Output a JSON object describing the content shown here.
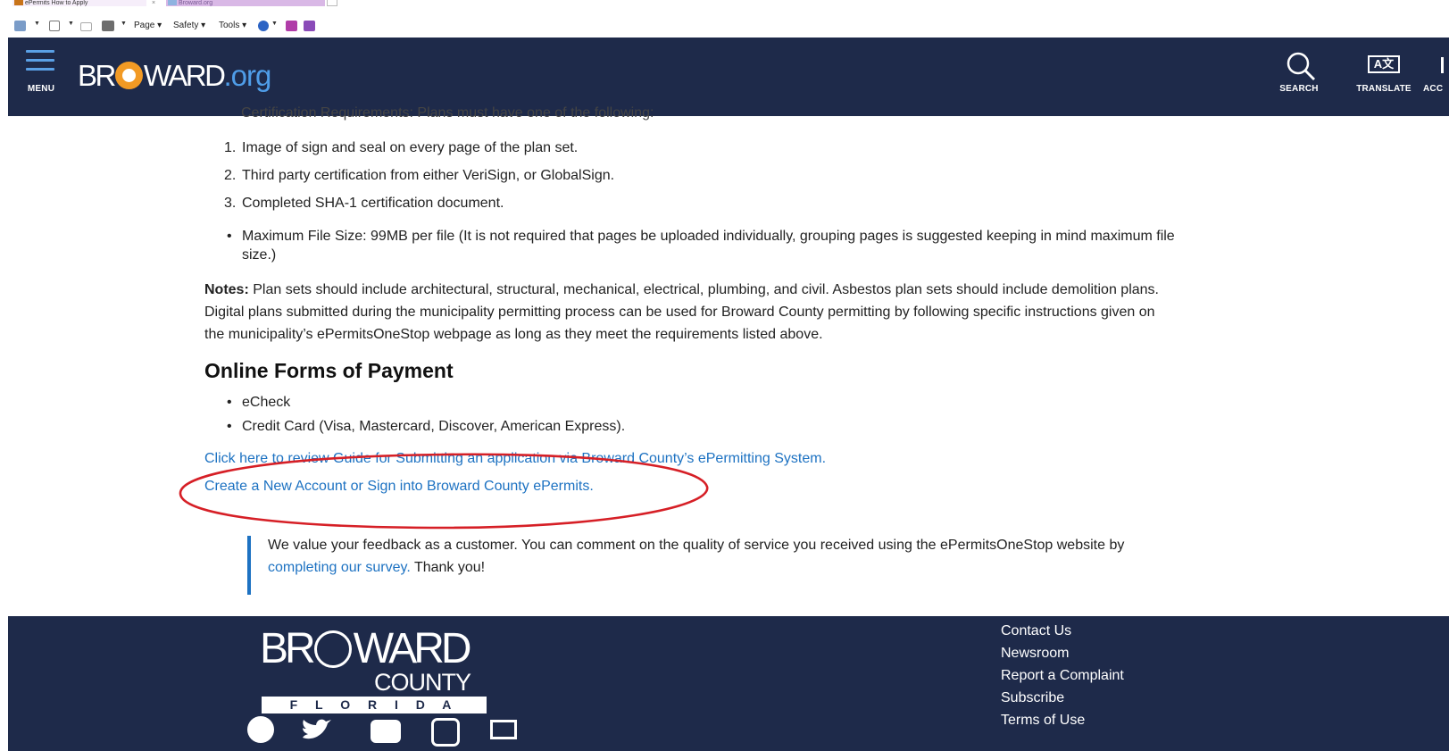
{
  "browser": {
    "tabs": [
      {
        "title": "ePermits How to Apply"
      },
      {
        "title": "Broward.org"
      }
    ],
    "toolbar": {
      "page_label": "Page",
      "safety_label": "Safety",
      "tools_label": "Tools"
    }
  },
  "header": {
    "menu_label": "MENU",
    "logo_text": "BR",
    "logo_text2": "WARD",
    "logo_org": ".org",
    "search_label": "SEARCH",
    "translate_label": "TRANSLATE",
    "translate_glyph": "A文",
    "accessibility_label": "ACC",
    "colors": {
      "background": "#1e2a4a",
      "accent": "#4f9de8",
      "sun": "#f29a24"
    }
  },
  "content": {
    "partial_line": "Certification Requirements: Plans must have one of the following:",
    "cert_items": [
      {
        "num": "1.",
        "text": "Image of sign and seal on every page of the plan set."
      },
      {
        "num": "2.",
        "text": "Third party certification from either VeriSign, or GlobalSign."
      },
      {
        "num": "3.",
        "text": "Completed SHA-1 certification document."
      }
    ],
    "file_size_line1": "Maximum File Size: 99MB per file (It is not required that pages be uploaded individually, grouping pages is suggested keeping in mind maximum file",
    "file_size_line2": "size.)",
    "notes_label": "Notes:",
    "notes_line1": " Plan sets should include architectural, structural, mechanical, electrical, plumbing, and civil.  Asbestos plan sets should include demolition plans.",
    "notes_line2": "Digital plans submitted during the municipality permitting process can be used for Broward County permitting by following specific instructions given on",
    "notes_line3": "the municipality’s ePermitsOneStop webpage as long as they meet the requirements listed above.",
    "payment_heading": "Online Forms of Payment",
    "payment_items": [
      "eCheck",
      "Credit Card (Visa, Mastercard, Discover, American Express)."
    ],
    "guide_link": "Click here to review Guide for Submitting an application via Broward County’s ePermitting System.",
    "account_link": "Create a New Account or Sign into Broward County ePermits.",
    "feedback_line1": "We value your feedback as a customer. You can comment on the quality of service you received using the ePermitsOneStop website by",
    "feedback_link": "completing our survey.",
    "feedback_thanks": " Thank you!",
    "annotation_color": "#d61f26"
  },
  "footer": {
    "logo_top_left": "BR",
    "logo_top_right": "WARD",
    "logo_county": "COUNTY",
    "logo_state": "F L O R I D A",
    "links": [
      "Contact Us",
      "Newsroom",
      "Report a Complaint",
      "Subscribe",
      "Terms of Use"
    ],
    "social_icons": [
      "facebook-icon",
      "twitter-icon",
      "youtube-icon",
      "instagram-icon",
      "email-icon"
    ]
  }
}
